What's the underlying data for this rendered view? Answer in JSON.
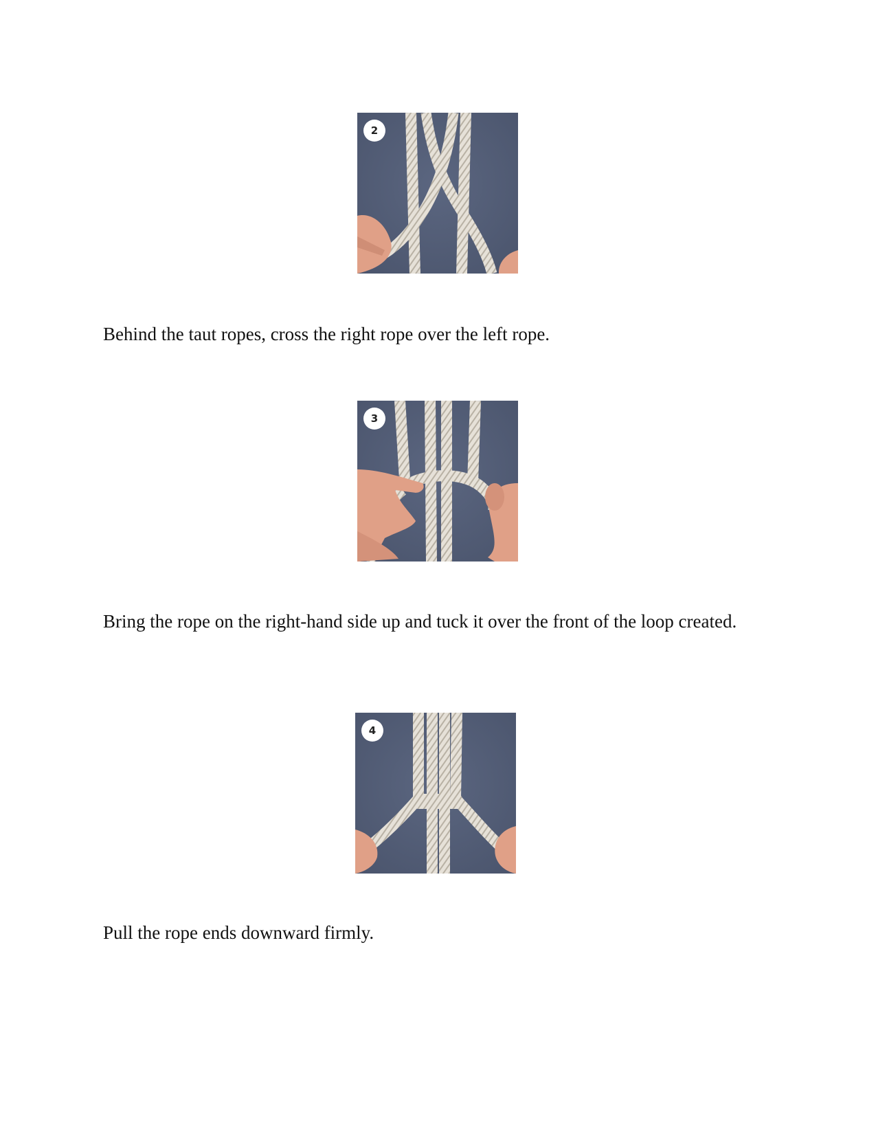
{
  "steps": [
    {
      "number": "2",
      "caption": "Behind the taut ropes, cross the right rope over the left rope."
    },
    {
      "number": "3",
      "caption": "Bring the rope on the right-hand side up and tuck it over the front of the loop created."
    },
    {
      "number": "4",
      "caption": "Pull the rope ends downward firmly."
    }
  ],
  "colors": {
    "background": "#55607a",
    "rope": "#e4dfd6",
    "rope_shadow": "#b9b2a6",
    "skin": "#e2a38a",
    "badge": "#ffffff"
  }
}
